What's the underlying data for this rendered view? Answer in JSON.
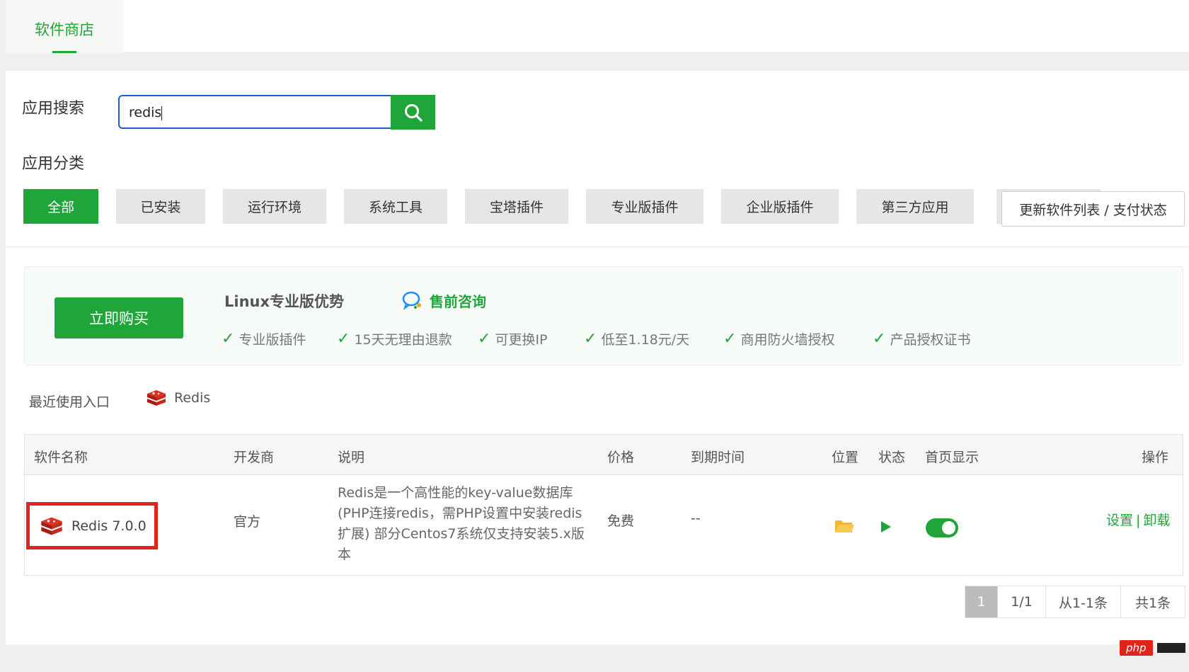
{
  "tabs": [
    {
      "label": "软件商店"
    }
  ],
  "search": {
    "label": "应用搜索",
    "value": "redis"
  },
  "categories": {
    "label": "应用分类",
    "items": [
      "全部",
      "已安装",
      "运行环境",
      "系统工具",
      "宝塔插件",
      "专业版插件",
      "企业版插件",
      "第三方应用"
    ],
    "active": "全部",
    "update_button": "更新软件列表 / 支付状态"
  },
  "promo": {
    "buy_button": "立即购买",
    "title": "Linux专业版优势",
    "consult": "售前咨询",
    "features": [
      "专业版插件",
      "15天无理由退款",
      "可更换IP",
      "低至1.18元/天",
      "商用防火墙授权",
      "产品授权证书"
    ]
  },
  "recent": {
    "label": "最近使用入口",
    "items": [
      "Redis"
    ]
  },
  "table": {
    "headers": {
      "name": "软件名称",
      "developer": "开发商",
      "description": "说明",
      "price": "价格",
      "expiry": "到期时间",
      "location": "位置",
      "status": "状态",
      "homepage": "首页显示",
      "actions": "操作"
    },
    "rows": [
      {
        "name": "Redis 7.0.0",
        "developer": "官方",
        "description": "Redis是一个高性能的key-value数据库(PHP连接redis，需PHP设置中安装redis扩展) 部分Centos7系统仅支持安装5.x版本",
        "price": "免费",
        "expiry": "--",
        "homepage_enabled": true,
        "action_settings": "设置",
        "action_separator": "|",
        "action_uninstall": "卸载"
      }
    ]
  },
  "pagination": {
    "current": "1",
    "pages": "1/1",
    "range": "从1-1条",
    "total": "共1条"
  },
  "watermark": {
    "text": "php"
  },
  "colors": {
    "accent": "#20a53a",
    "highlight_border": "#e1231a",
    "search_border": "#1a5fd0"
  },
  "icons": [
    "search-icon",
    "chat-icon",
    "check-icon",
    "redis-icon",
    "folder-icon",
    "play-icon"
  ]
}
